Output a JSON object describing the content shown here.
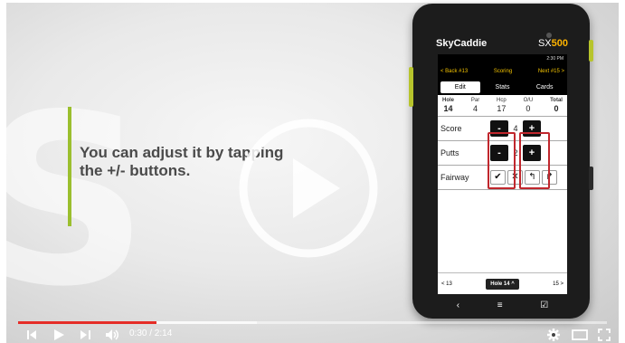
{
  "video": {
    "caption": "You can adjust it by tapping the +/- buttons."
  },
  "phone": {
    "brand": "SkyCaddie",
    "model_prefix": "SX",
    "model_number": "500",
    "status_time": "2:30 PM",
    "nav": {
      "back": "< Back #13",
      "title": "Scoring",
      "next": "Next #15 >"
    },
    "tabs": [
      {
        "label": "Edit",
        "active": true
      },
      {
        "label": "Stats",
        "active": false
      },
      {
        "label": "Cards",
        "active": false
      }
    ],
    "hole_info": {
      "headers": [
        "Hole",
        "Par",
        "Hcp",
        "O/U",
        "Total"
      ],
      "values": [
        "14",
        "4",
        "17",
        "0",
        "0"
      ]
    },
    "score": {
      "label": "Score",
      "value": "4",
      "minus": "-",
      "plus": "+"
    },
    "putts": {
      "label": "Putts",
      "value": "2",
      "minus": "-",
      "plus": "+"
    },
    "fairway": {
      "label": "Fairway",
      "hit": "✔",
      "miss": "✕",
      "left": "↰",
      "right": "↱"
    },
    "hole_bar": {
      "prev": "< 13",
      "current": "Hole 14 ^",
      "next": "15 >"
    },
    "softkeys": {
      "back": "‹",
      "menu": "≡",
      "edit": "☑"
    }
  },
  "player": {
    "current_time": "0:30",
    "duration": "2:14",
    "time_display": "0:30 / 2:14",
    "progress_played_fraction": 0.224,
    "accent_color": "#e52d27"
  },
  "colors": {
    "accent_bar": "#9bbf2e",
    "highlight_box": "#c0272d"
  }
}
